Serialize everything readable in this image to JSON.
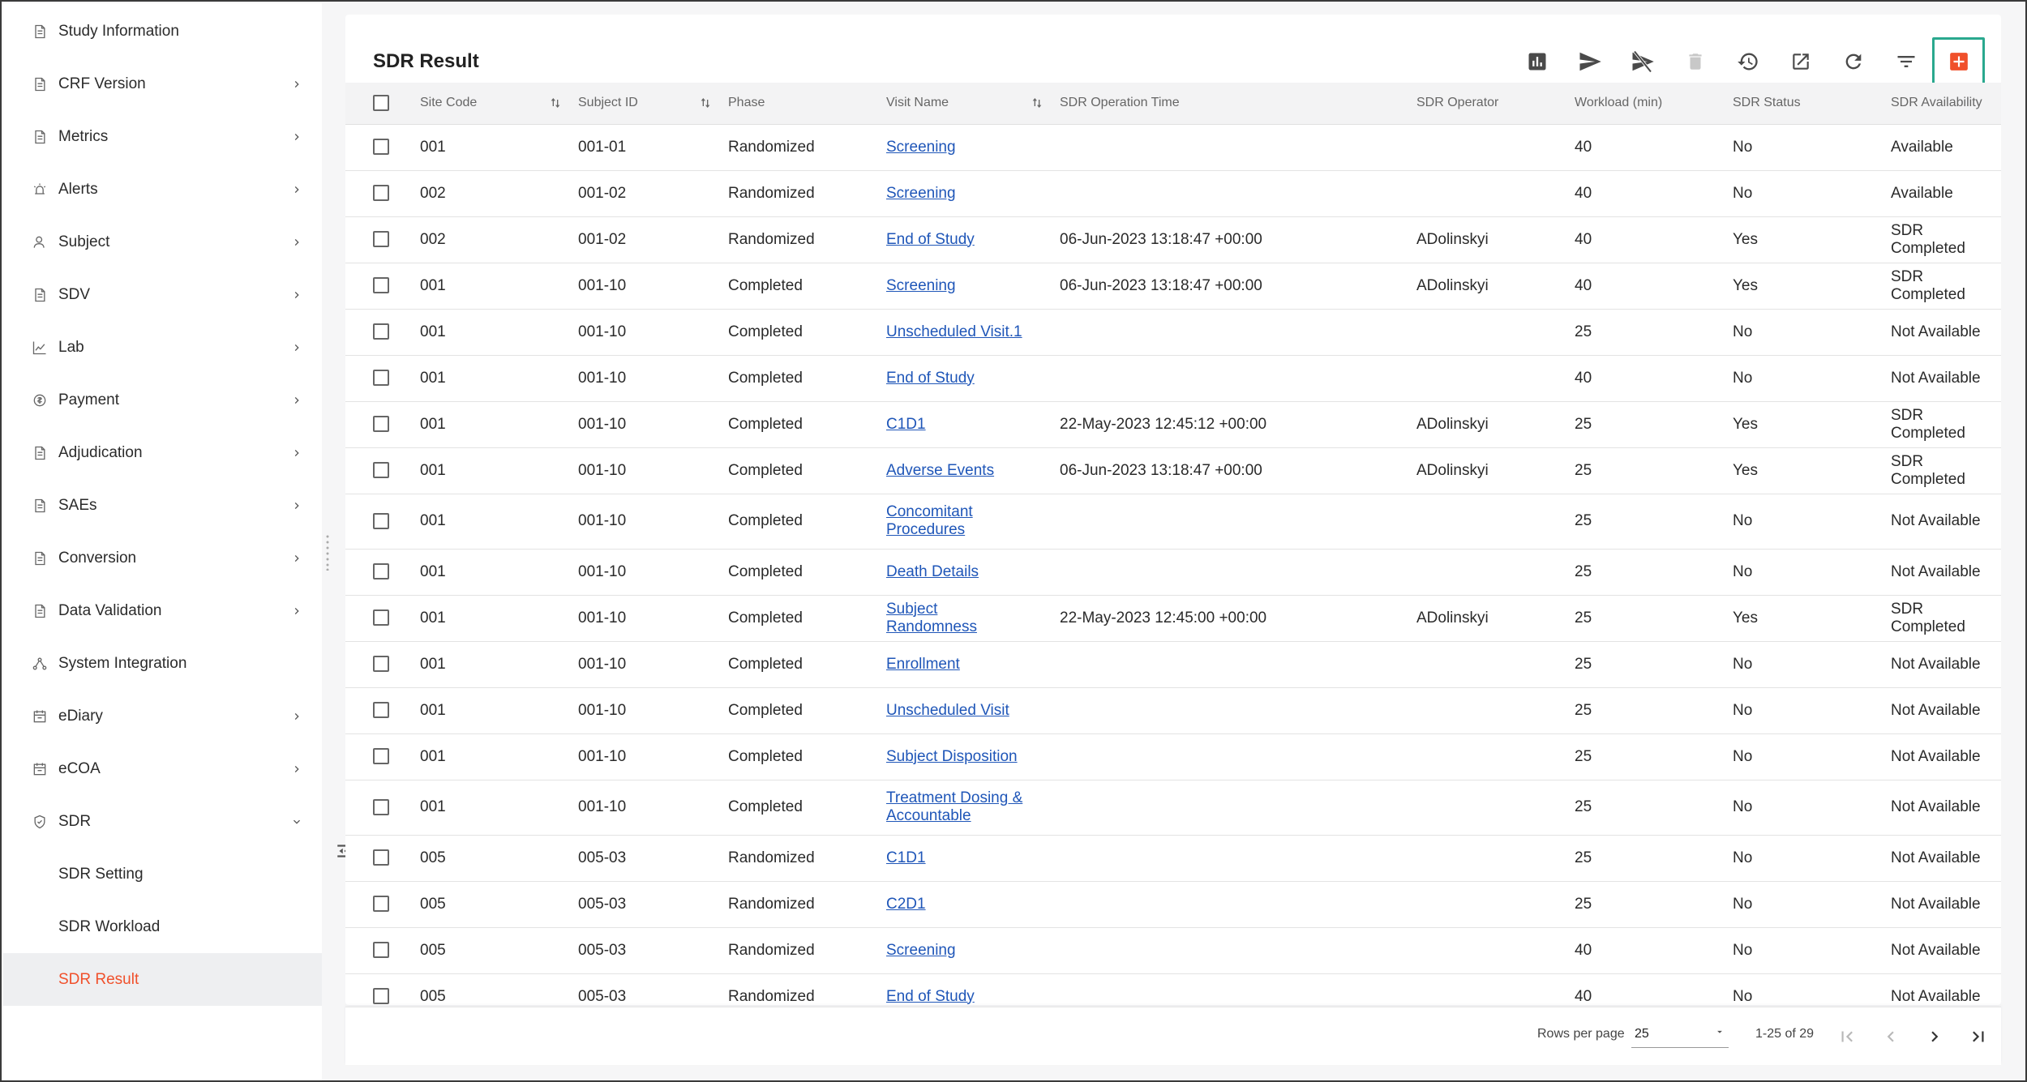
{
  "sidebar": {
    "items": [
      {
        "label": "Study Information",
        "icon": "document-icon",
        "expandable": false
      },
      {
        "label": "CRF Version",
        "icon": "document-icon",
        "expandable": true
      },
      {
        "label": "Metrics",
        "icon": "document-icon",
        "expandable": true
      },
      {
        "label": "Alerts",
        "icon": "alarm-icon",
        "expandable": true
      },
      {
        "label": "Subject",
        "icon": "person-icon",
        "expandable": true
      },
      {
        "label": "SDV",
        "icon": "document-icon",
        "expandable": true
      },
      {
        "label": "Lab",
        "icon": "chart-line-icon",
        "expandable": true
      },
      {
        "label": "Payment",
        "icon": "payment-icon",
        "expandable": true
      },
      {
        "label": "Adjudication",
        "icon": "document-icon",
        "expandable": true
      },
      {
        "label": "SAEs",
        "icon": "document-icon",
        "expandable": true
      },
      {
        "label": "Conversion",
        "icon": "document-icon",
        "expandable": true
      },
      {
        "label": "Data Validation",
        "icon": "document-icon",
        "expandable": true
      },
      {
        "label": "System Integration",
        "icon": "integration-icon",
        "expandable": false
      },
      {
        "label": "eDiary",
        "icon": "calendar-icon",
        "expandable": true
      },
      {
        "label": "eCOA",
        "icon": "calendar-icon",
        "expandable": true
      },
      {
        "label": "SDR",
        "icon": "shield-icon",
        "expandable": true,
        "expanded": true
      }
    ],
    "sdr_children": [
      "SDR Setting",
      "SDR Workload",
      "SDR Result"
    ],
    "active_child": "SDR Result",
    "active_color": "#f0502b"
  },
  "main": {
    "title": "SDR Result",
    "toolbar": [
      {
        "name": "report-chart-icon",
        "tooltip": "",
        "disabled": false
      },
      {
        "name": "send-icon",
        "disabled": false
      },
      {
        "name": "unsend-icon",
        "disabled": false
      },
      {
        "name": "delete-icon",
        "disabled": true
      },
      {
        "name": "history-icon",
        "disabled": false
      },
      {
        "name": "open-external-icon",
        "disabled": false
      },
      {
        "name": "refresh-icon",
        "disabled": false
      },
      {
        "name": "filter-icon",
        "disabled": false
      },
      {
        "name": "add-icon",
        "disabled": false,
        "highlighted": true
      }
    ],
    "columns": [
      "Site Code",
      "Subject ID",
      "Phase",
      "Visit Name",
      "SDR Operation Time",
      "SDR Operator",
      "Workload (min)",
      "SDR Status",
      "SDR Availability"
    ],
    "sortable_columns": [
      "Site Code",
      "Subject ID",
      "Visit Name"
    ],
    "rows": [
      {
        "site": "001",
        "subject": "001-01",
        "phase": "Randomized",
        "visit": "Screening",
        "time": "",
        "operator": "",
        "workload": "40",
        "status": "No",
        "availability": "Available"
      },
      {
        "site": "002",
        "subject": "001-02",
        "phase": "Randomized",
        "visit": "Screening",
        "time": "",
        "operator": "",
        "workload": "40",
        "status": "No",
        "availability": "Available"
      },
      {
        "site": "002",
        "subject": "001-02",
        "phase": "Randomized",
        "visit": "End of Study",
        "time": "06-Jun-2023 13:18:47 +00:00",
        "operator": "ADolinskyi",
        "workload": "40",
        "status": "Yes",
        "availability": "SDR Completed"
      },
      {
        "site": "001",
        "subject": "001-10",
        "phase": "Completed",
        "visit": "Screening",
        "time": "06-Jun-2023 13:18:47 +00:00",
        "operator": "ADolinskyi",
        "workload": "40",
        "status": "Yes",
        "availability": "SDR Completed"
      },
      {
        "site": "001",
        "subject": "001-10",
        "phase": "Completed",
        "visit": "Unscheduled Visit.1",
        "time": "",
        "operator": "",
        "workload": "25",
        "status": "No",
        "availability": "Not Available"
      },
      {
        "site": "001",
        "subject": "001-10",
        "phase": "Completed",
        "visit": "End of Study",
        "time": "",
        "operator": "",
        "workload": "40",
        "status": "No",
        "availability": "Not Available"
      },
      {
        "site": "001",
        "subject": "001-10",
        "phase": "Completed",
        "visit": "C1D1",
        "time": "22-May-2023 12:45:12 +00:00",
        "operator": "ADolinskyi",
        "workload": "25",
        "status": "Yes",
        "availability": "SDR Completed"
      },
      {
        "site": "001",
        "subject": "001-10",
        "phase": "Completed",
        "visit": "Adverse Events",
        "time": "06-Jun-2023 13:18:47 +00:00",
        "operator": "ADolinskyi",
        "workload": "25",
        "status": "Yes",
        "availability": "SDR Completed"
      },
      {
        "site": "001",
        "subject": "001-10",
        "phase": "Completed",
        "visit": "Concomitant Procedures",
        "time": "",
        "operator": "",
        "workload": "25",
        "status": "No",
        "availability": "Not Available",
        "tall": true
      },
      {
        "site": "001",
        "subject": "001-10",
        "phase": "Completed",
        "visit": "Death Details",
        "time": "",
        "operator": "",
        "workload": "25",
        "status": "No",
        "availability": "Not Available"
      },
      {
        "site": "001",
        "subject": "001-10",
        "phase": "Completed",
        "visit": "Subject Randomness",
        "time": "22-May-2023 12:45:00 +00:00",
        "operator": "ADolinskyi",
        "workload": "25",
        "status": "Yes",
        "availability": "SDR Completed"
      },
      {
        "site": "001",
        "subject": "001-10",
        "phase": "Completed",
        "visit": "Enrollment",
        "time": "",
        "operator": "",
        "workload": "25",
        "status": "No",
        "availability": "Not Available"
      },
      {
        "site": "001",
        "subject": "001-10",
        "phase": "Completed",
        "visit": "Unscheduled Visit",
        "time": "",
        "operator": "",
        "workload": "25",
        "status": "No",
        "availability": "Not Available"
      },
      {
        "site": "001",
        "subject": "001-10",
        "phase": "Completed",
        "visit": "Subject Disposition",
        "time": "",
        "operator": "",
        "workload": "25",
        "status": "No",
        "availability": "Not Available"
      },
      {
        "site": "001",
        "subject": "001-10",
        "phase": "Completed",
        "visit": "Treatment Dosing & Accountable",
        "time": "",
        "operator": "",
        "workload": "25",
        "status": "No",
        "availability": "Not Available",
        "tall": true
      },
      {
        "site": "005",
        "subject": "005-03",
        "phase": "Randomized",
        "visit": "C1D1",
        "time": "",
        "operator": "",
        "workload": "25",
        "status": "No",
        "availability": "Not Available"
      },
      {
        "site": "005",
        "subject": "005-03",
        "phase": "Randomized",
        "visit": "C2D1",
        "time": "",
        "operator": "",
        "workload": "25",
        "status": "No",
        "availability": "Not Available"
      },
      {
        "site": "005",
        "subject": "005-03",
        "phase": "Randomized",
        "visit": "Screening",
        "time": "",
        "operator": "",
        "workload": "40",
        "status": "No",
        "availability": "Not Available"
      },
      {
        "site": "005",
        "subject": "005-03",
        "phase": "Randomized",
        "visit": "End of Study",
        "time": "",
        "operator": "",
        "workload": "40",
        "status": "No",
        "availability": "Not Available"
      }
    ]
  },
  "pagination": {
    "rows_per_page_label": "Rows per page",
    "rows_per_page_value": "25",
    "range_text": "1-25 of 29"
  },
  "colors": {
    "accent": "#f0502b",
    "highlight_border": "#2aa88e",
    "link": "#1f56b8"
  }
}
